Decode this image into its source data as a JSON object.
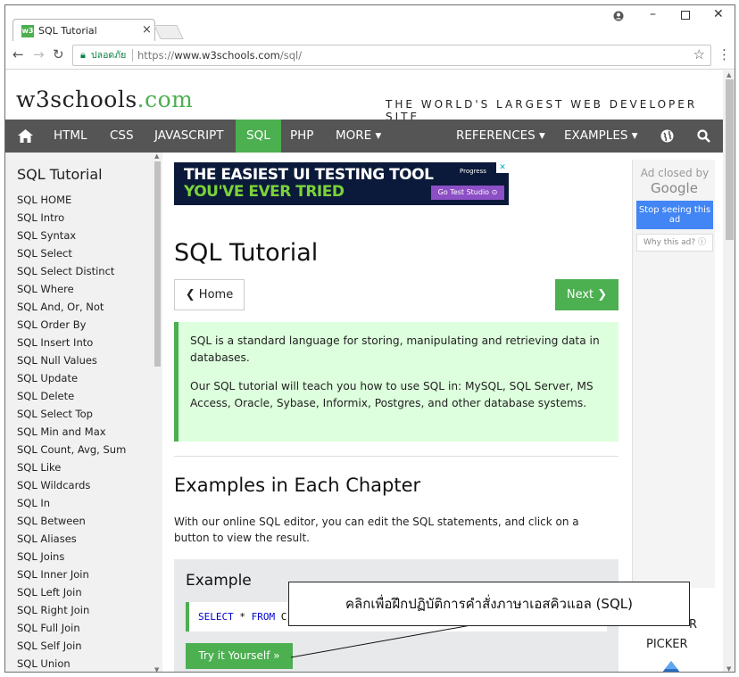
{
  "browser": {
    "tab_title": "SQL Tutorial",
    "tab_favicon": "w3",
    "tab_close": "×",
    "secure_label": "ปลอดภัย",
    "url_scheme": "https://",
    "url_host": "www.w3schools.com",
    "url_path": "/sql/",
    "icons": [
      "back-icon",
      "forward-icon",
      "reload-icon",
      "lock-icon",
      "star-icon",
      "menu-icon",
      "account-icon",
      "minimize-icon",
      "maximize-icon",
      "close-icon"
    ]
  },
  "site": {
    "logo_main": "w3schools",
    "logo_dot": ".com",
    "slogan": "THE WORLD'S LARGEST WEB DEVELOPER SITE",
    "nav": {
      "html": "HTML",
      "css": "CSS",
      "javascript": "JAVASCRIPT",
      "sql": "SQL",
      "php": "PHP",
      "more": "MORE ▾",
      "references": "REFERENCES ▾",
      "examples": "EXAMPLES ▾"
    },
    "accent": "#4CAF50"
  },
  "sidebar": {
    "title": "SQL Tutorial",
    "items": [
      "SQL HOME",
      "SQL Intro",
      "SQL Syntax",
      "SQL Select",
      "SQL Select Distinct",
      "SQL Where",
      "SQL And, Or, Not",
      "SQL Order By",
      "SQL Insert Into",
      "SQL Null Values",
      "SQL Update",
      "SQL Delete",
      "SQL Select Top",
      "SQL Min and Max",
      "SQL Count, Avg, Sum",
      "SQL Like",
      "SQL Wildcards",
      "SQL In",
      "SQL Between",
      "SQL Aliases",
      "SQL Joins",
      "SQL Inner Join",
      "SQL Left Join",
      "SQL Right Join",
      "SQL Full Join",
      "SQL Self Join",
      "SQL Union"
    ]
  },
  "ad": {
    "line1": "THE EASIEST UI TESTING TOOL",
    "line2": "YOU'VE EVER TRIED",
    "brand": "Progress",
    "cta": "Go Test Studio ⊙"
  },
  "main": {
    "title": "SQL Tutorial",
    "home_button": "❮ Home",
    "next_button": "Next ❯",
    "notice_p1": "SQL is a standard language for storing, manipulating and retrieving data in databases.",
    "notice_p2": "Our SQL tutorial will teach you how to use SQL in: MySQL, SQL Server, MS Access, Oracle, Sybase, Informix, Postgres, and other database systems.",
    "section_title": "Examples in Each Chapter",
    "section_text": "With our online SQL editor, you can edit the SQL statements, and click on a button to view the result.",
    "example_title": "Example",
    "code_kw1": "SELECT",
    "code_op": " * ",
    "code_kw2": "FROM",
    "code_rest": " C",
    "try_button": "Try it Yourself »"
  },
  "right_ad": {
    "closed_by": "Ad closed by",
    "google": "Google",
    "stop_seeing": "Stop seeing this ad",
    "why": "Why this ad? ⓘ"
  },
  "picker": {
    "prev_fragment": "R",
    "label": "PICKER"
  },
  "callout": {
    "text": "คลิกเพื่อฝึกปฏิบัติการคำสั่งภาษาเอสคิวแอล (SQL)"
  }
}
